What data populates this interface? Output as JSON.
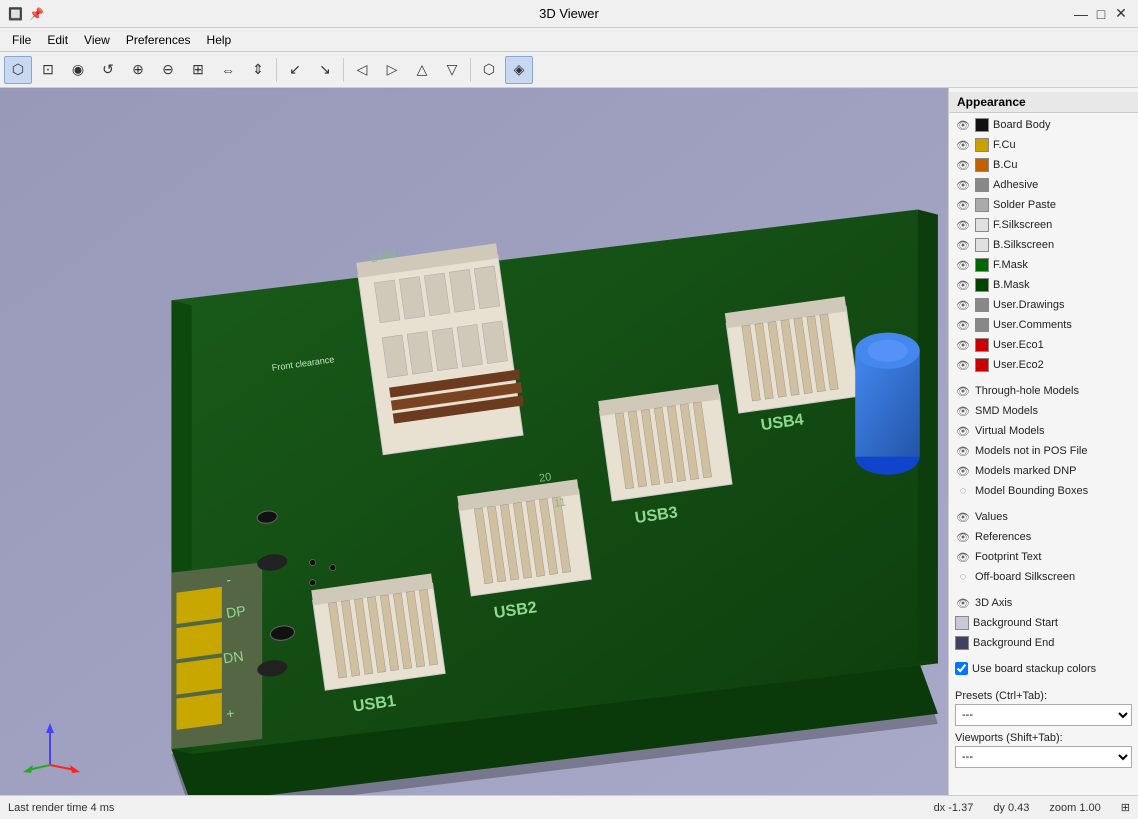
{
  "titlebar": {
    "title": "3D Viewer",
    "icon": "⚙",
    "pin": "📌",
    "minimize": "—",
    "maximize": "□",
    "close": "✕"
  },
  "menubar": {
    "items": [
      "File",
      "Edit",
      "View",
      "Preferences",
      "Help"
    ]
  },
  "toolbar": {
    "buttons": [
      {
        "id": "new",
        "icon": "⬡",
        "active": true
      },
      {
        "id": "open",
        "icon": "⊡"
      },
      {
        "id": "3d",
        "icon": "◉"
      },
      {
        "id": "undo",
        "icon": "↺"
      },
      {
        "id": "zoom-in",
        "icon": "⊕"
      },
      {
        "id": "zoom-out",
        "icon": "⊖"
      },
      {
        "id": "zoom-fit",
        "icon": "⊞"
      },
      {
        "id": "flip-x",
        "icon": "⇔"
      },
      {
        "id": "flip-y",
        "icon": "⇕"
      },
      {
        "id": "sep1",
        "sep": true
      },
      {
        "id": "rot-left",
        "icon": "↙"
      },
      {
        "id": "rot-right",
        "icon": "↘"
      },
      {
        "id": "sep2",
        "sep": true
      },
      {
        "id": "pan-left",
        "icon": "◁"
      },
      {
        "id": "pan-right",
        "icon": "▷"
      },
      {
        "id": "pan-up",
        "icon": "△"
      },
      {
        "id": "pan-down",
        "icon": "▽"
      },
      {
        "id": "sep3",
        "sep": true
      },
      {
        "id": "wireframe",
        "icon": "⬡"
      },
      {
        "id": "render",
        "icon": "◈",
        "active": true
      }
    ]
  },
  "appearance": {
    "header": "Appearance",
    "items": [
      {
        "id": "board-body",
        "label": "Board Body",
        "color": "#111111",
        "eye": true,
        "visible": true
      },
      {
        "id": "fcu",
        "label": "F.Cu",
        "color": "#c8a000",
        "eye": true,
        "visible": true
      },
      {
        "id": "bcu",
        "label": "B.Cu",
        "color": "#c06000",
        "eye": true,
        "visible": true
      },
      {
        "id": "adhesive",
        "label": "Adhesive",
        "color": "#888888",
        "eye": true,
        "visible": true
      },
      {
        "id": "solder-paste",
        "label": "Solder Paste",
        "color": "#aaaaaa",
        "eye": true,
        "visible": true
      },
      {
        "id": "f-silkscreen",
        "label": "F.Silkscreen",
        "color": "#e0e0e0",
        "eye": true,
        "visible": true
      },
      {
        "id": "b-silkscreen",
        "label": "B.Silkscreen",
        "color": "#e0e0e0",
        "eye": true,
        "visible": true
      },
      {
        "id": "f-mask",
        "label": "F.Mask",
        "color": "#006600",
        "eye": true,
        "visible": true
      },
      {
        "id": "b-mask",
        "label": "B.Mask",
        "color": "#004400",
        "eye": true,
        "visible": true
      },
      {
        "id": "user-drawings",
        "label": "User.Drawings",
        "color": "#888888",
        "eye": true,
        "visible": true
      },
      {
        "id": "user-comments",
        "label": "User.Comments",
        "color": "#888888",
        "eye": true,
        "visible": true
      },
      {
        "id": "user-eco1",
        "label": "User.Eco1",
        "color": "#cc0000",
        "eye": true,
        "visible": true
      },
      {
        "id": "user-eco2",
        "label": "User.Eco2",
        "color": "#cc0000",
        "eye": true,
        "visible": true
      }
    ],
    "model_items": [
      {
        "id": "through-hole",
        "label": "Through-hole Models",
        "eye": true
      },
      {
        "id": "smd",
        "label": "SMD Models",
        "eye": true
      },
      {
        "id": "virtual",
        "label": "Virtual Models",
        "eye": true
      },
      {
        "id": "not-pos",
        "label": "Models not in POS File",
        "eye": true
      },
      {
        "id": "dnp",
        "label": "Models marked DNP",
        "eye": true
      },
      {
        "id": "bounding-boxes",
        "label": "Model Bounding Boxes",
        "eye": false
      }
    ],
    "text_items": [
      {
        "id": "values",
        "label": "Values",
        "eye": true
      },
      {
        "id": "references",
        "label": "References",
        "eye": true
      },
      {
        "id": "footprint-text",
        "label": "Footprint Text",
        "eye": true
      },
      {
        "id": "offboard-silk",
        "label": "Off-board Silkscreen",
        "eye": false
      }
    ],
    "misc_items": [
      {
        "id": "3d-axis",
        "label": "3D Axis",
        "eye": true
      }
    ],
    "bg_items": [
      {
        "id": "bg-start",
        "label": "Background Start",
        "color": "#c8c8d8"
      },
      {
        "id": "bg-end",
        "label": "Background End",
        "color": "#404060"
      }
    ],
    "use_board_stackup": true,
    "use_board_stackup_label": "Use board stackup colors"
  },
  "presets": {
    "label": "Presets (Ctrl+Tab):",
    "value": "---",
    "options": [
      "---"
    ]
  },
  "viewports": {
    "label": "Viewports (Shift+Tab):",
    "value": "---",
    "options": [
      "---"
    ]
  },
  "statusbar": {
    "render_time": "Last render time 4 ms",
    "dx": "dx -1.37",
    "dy": "dy 0.43",
    "zoom": "zoom 1.00",
    "grid_icon": "⊞"
  }
}
